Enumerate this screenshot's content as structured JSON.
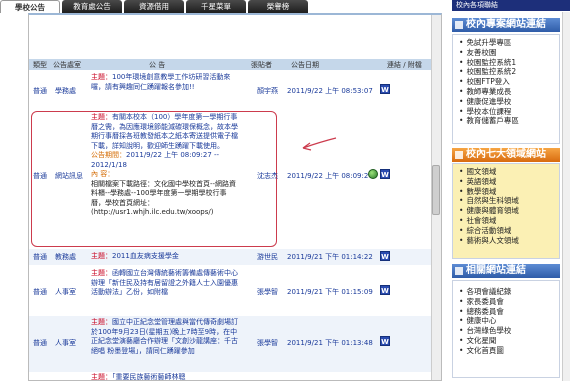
{
  "tabs": [
    "學校公告",
    "教育處公告",
    "資源借用",
    "千星菜單",
    "榮譽榜"
  ],
  "table": {
    "headers": {
      "type": "類型",
      "office": "公告處室",
      "title": "公 告",
      "poster": "張貼者",
      "date": "公告日期",
      "attach": "連結 / 附檔"
    },
    "rows": [
      {
        "type": "普通",
        "office": "學務處",
        "label": "主題：",
        "text": "100年環境創意教學工作坊研習活動來囉，請有興趣同仁踴躍報名參加!!",
        "poster": "顏宇燕",
        "date": "2011/9/22 上午 08:53:07",
        "attach": "W"
      },
      {
        "type": "普通",
        "office": "網站訊息",
        "label": "主題：",
        "text": "有關本校本（100）學年度第一學期行事曆之需，為因應環境節能減碳環保概念，故本學期行事曆採各班教發紙本之紙本寄送提供電子檔下載，詳知說明，歡迎師生踴躍下載使用。",
        "period_label": "公告期間：",
        "period": "2011/9/22 上午 08:09:27 -- 2012/1/18",
        "content_label": "內 容：",
        "content": "相關檔案下載路徑：文化國中學校首頁--網路資料櫃--學務處--100學年度第一學期學校行事曆，學校首頁網址：(http://usr1.whjh.ilc.edu.tw/xoops/)",
        "poster": "沈志杰",
        "date": "2011/9/22 上午 08:09:27",
        "attach": "W"
      },
      {
        "type": "普通",
        "office": "教務處",
        "label": "主題：",
        "text": "2011血友病支援學金",
        "poster": "游世民",
        "date": "2011/9/21 下午 01:14:22",
        "attach": "W"
      },
      {
        "type": "普通",
        "office": "人事室",
        "label": "主題：",
        "text": "函轉國立台灣傳統藝術籌備處傳藝術中心辦理「新住民及持有居留證之外籍人士入園優惠活動辦法」乙份，如附檔",
        "poster": "張學智",
        "date": "2011/9/21 下午 01:15:09",
        "attach": "W"
      },
      {
        "type": "普通",
        "office": "人事室",
        "label": "主題：",
        "text": "國立中正紀念堂管理處與當代傳奇劇場訂於100年9月23日(星期五)晚上7時至9時，在中正紀念堂演藝廳合作辦理「文創沙龍講座：千古絕唱 粉墨登場」，請同仁踴躍參加",
        "poster": "張學智",
        "date": "2011/9/21 下午 01:13:48",
        "attach": "W"
      },
      {
        "type": "",
        "office": "",
        "label": "主題：",
        "text": "「重要民族藝術藝師林聰",
        "poster": "",
        "date": "",
        "attach": ""
      }
    ]
  },
  "sidebar": {
    "title": "校內各項聯結",
    "banner1": "校內專案網站連結",
    "list1": [
      "免試升學專區",
      "友善校園",
      "校園監控系統1",
      "校園監控系統2",
      "校園FTP登入",
      "教師專業成長",
      "健康促進學校",
      "學校本位課程",
      "教育儲蓄戶專區"
    ],
    "banner2": "校內七大領域網站",
    "list2": [
      "國文領域",
      "英語領域",
      "數學領域",
      "自然與生科領域",
      "健康與體育領域",
      "社會領域",
      "綜合活動領域",
      "藝術與人文領域"
    ],
    "banner3": "相關網站連結",
    "list3": [
      "各項會議紀錄",
      "家長委員會",
      "總務委員會",
      "健康中心",
      "台灣綠色學校",
      "文化星聞",
      "文化首頁圖"
    ]
  },
  "colors": {
    "accent": "#1d2f7a",
    "highlight": "#cc3b4d",
    "subject": "#c8001e"
  }
}
